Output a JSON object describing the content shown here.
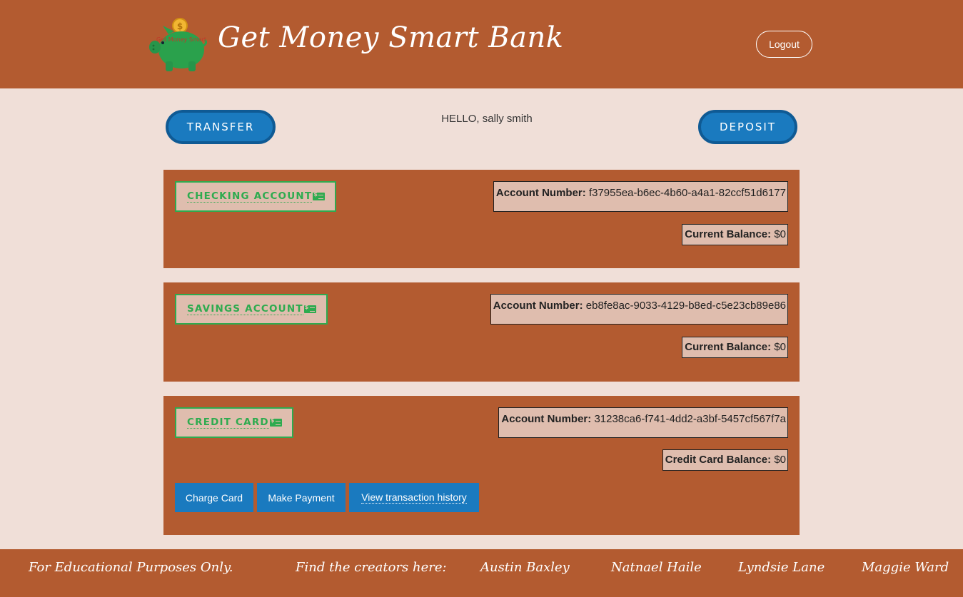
{
  "header": {
    "title": "Get Money Smart Bank",
    "logo_text": "Get Money Smart",
    "logout_label": "Logout"
  },
  "actions": {
    "transfer_label": "TRANSFER",
    "deposit_label": "DEPOSIT",
    "greeting": "HELLO, sally smith"
  },
  "accounts": [
    {
      "name": "CHECKING ACCOUNT",
      "account_number_label": "Account Number:",
      "account_number": "f37955ea-b6ec-4b60-a4a1-82ccf51d6177",
      "balance_label": "Current Balance:",
      "balance": "$0"
    },
    {
      "name": "SAVINGS ACCOUNT",
      "account_number_label": "Account Number:",
      "account_number": "eb8fe8ac-9033-4129-b8ed-c5e23cb89e86",
      "balance_label": "Current Balance:",
      "balance": "$0"
    },
    {
      "name": "CREDIT CARD",
      "account_number_label": "Account Number:",
      "account_number": "31238ca6-f741-4dd2-a3bf-5457cf567f7a",
      "balance_label": "Credit Card Balance:",
      "balance": "$0",
      "buttons": {
        "charge": "Charge Card",
        "payment": "Make Payment",
        "history": "View transaction history"
      }
    }
  ],
  "footer": {
    "disclaimer": "For Educational Purposes Only.",
    "creators_label": "Find the creators here:",
    "creators": [
      "Austin Baxley",
      "Natnael Haile",
      "Lyndsie Lane",
      "Maggie Ward"
    ]
  },
  "colors": {
    "brand_rust": "#b35b30",
    "page_bg": "#f0dfd8",
    "button_blue": "#1a7abf",
    "account_green": "#2eab4f",
    "box_tan": "#dfbdae"
  },
  "icons": [
    "piggy-bank-logo",
    "money-bill-icon"
  ]
}
